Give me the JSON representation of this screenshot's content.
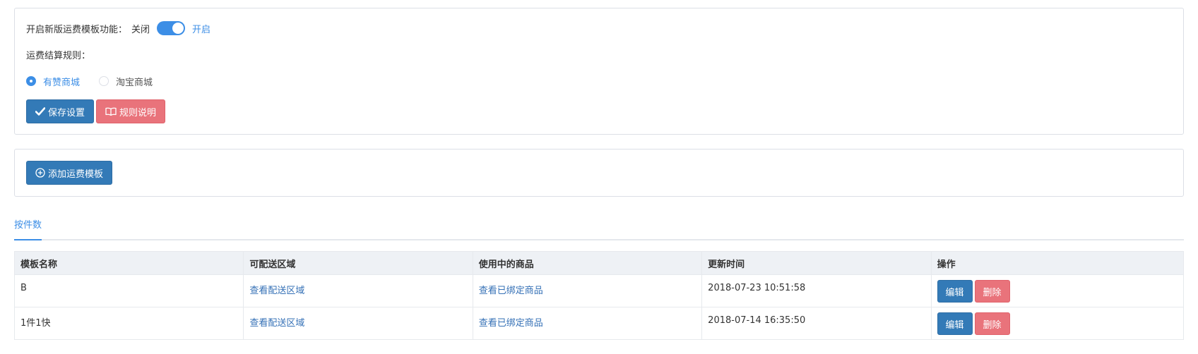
{
  "settings": {
    "toggle_label": "开启新版运费模板功能：",
    "toggle_off_text": "关闭",
    "toggle_on_text": "开启",
    "toggle_state": "on",
    "rule_title": "运费结算规则：",
    "radios": [
      {
        "label": "有赞商城",
        "checked": true
      },
      {
        "label": "淘宝商城",
        "checked": false
      }
    ],
    "save_label": "保存设置",
    "rules_label": "规则说明"
  },
  "add_button_label": "添加运费模板",
  "tab_label": "按件数",
  "table": {
    "headers": [
      "模板名称",
      "可配送区域",
      "使用中的商品",
      "更新时间",
      "操作"
    ],
    "rows": [
      {
        "name": "B",
        "area_link": "查看配送区域",
        "goods_link": "查看已绑定商品",
        "updated": "2018-07-23 10:51:58",
        "edit": "编辑",
        "delete": "删除"
      },
      {
        "name": "1件1快",
        "area_link": "查看配送区域",
        "goods_link": "查看已绑定商品",
        "updated": "2018-07-14 16:35:50",
        "edit": "编辑",
        "delete": "删除"
      }
    ]
  },
  "colors": {
    "accent": "#3c8ee6",
    "primary": "#337ab7",
    "danger": "#e9737b",
    "link": "#3470b6"
  },
  "icons": {
    "save": "check-icon",
    "rules": "book-icon",
    "add": "plus-circle-icon"
  }
}
